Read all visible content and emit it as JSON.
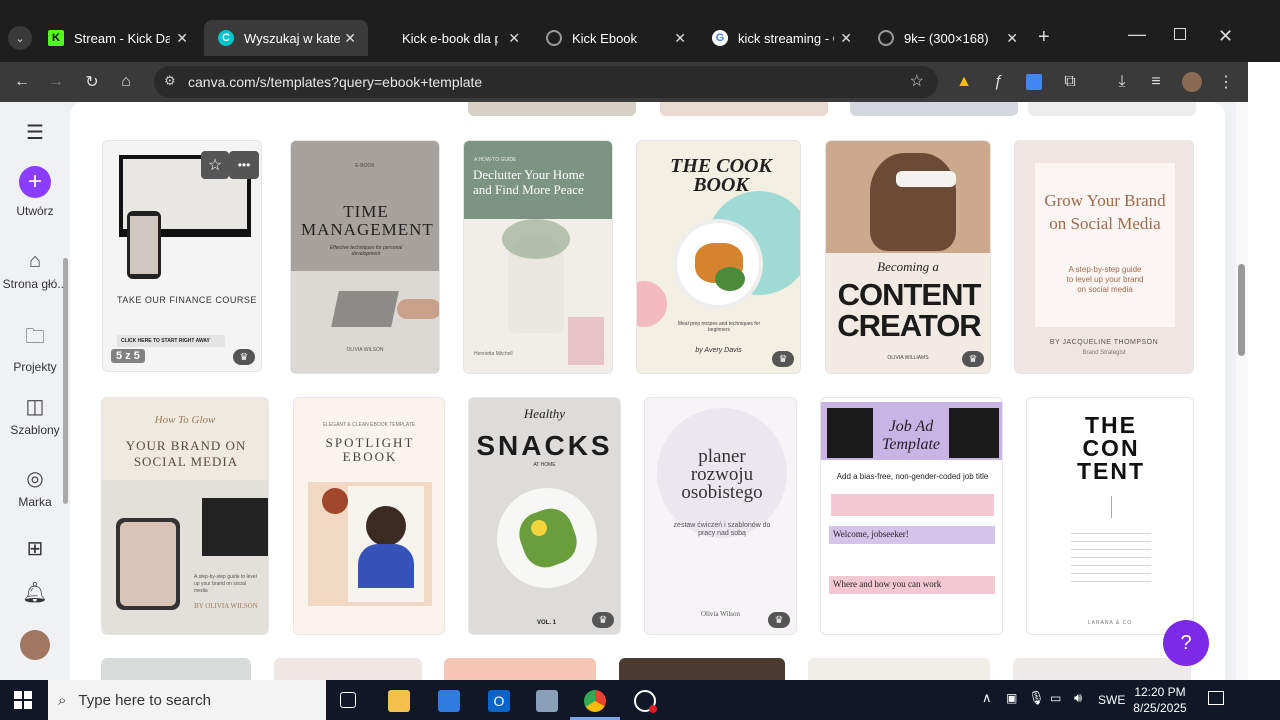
{
  "browser": {
    "tabs": [
      {
        "title": "Stream - Kick Dash",
        "icon": "kick-icon"
      },
      {
        "title": "Wyszukaj w kateg",
        "icon": "canva-icon"
      },
      {
        "title": "Kick e-book dla p",
        "icon": "kick-icon"
      },
      {
        "title": "Kick Ebook",
        "icon": "globe-icon"
      },
      {
        "title": "kick streaming - G",
        "icon": "google-icon"
      },
      {
        "title": "9k= (300×168)",
        "icon": "globe-icon"
      }
    ],
    "url": "canva.com/s/templates?query=ebook+template"
  },
  "sidebar": {
    "create_label": "Utwórz",
    "home_label": "Strona głó...",
    "projects_label": "Projekty",
    "templates_label": "Szablony",
    "brand_label": "Marka"
  },
  "templates": {
    "row1": [
      {
        "title": "TAKE OUR FINANCE COURSE",
        "subtitle": "CLICK HERE TO START RIGHT AWAY",
        "badge": "5 z 5"
      },
      {
        "title": "TIME MANAGEMENT",
        "kicker": "E-BOOK",
        "subtitle": "Effective techniques for personal development",
        "author": "OLIVIA WILSON"
      },
      {
        "title": "Declutter Your Home and Find More Peace",
        "kicker": "A HOW-TO GUIDE",
        "author": "Henrietta Mitchell"
      },
      {
        "title": "THE COOK BOOK",
        "subtitle": "Meal prep recipes and techniques for beginners",
        "author": "by Avery Davis"
      },
      {
        "title": "CONTENT CREATOR",
        "kicker": "Becoming a",
        "author": "OLIVIA WILLIAMS"
      },
      {
        "title": "Grow Your Brand on Social Media",
        "subtitle": "A step-by-step guide to level up your brand on social media",
        "author": "BY JACQUELINE THOMPSON",
        "role": "Brand Strategist"
      }
    ],
    "row2": [
      {
        "title": "YOUR BRAND ON SOCIAL MEDIA",
        "kicker": "How To Glow",
        "subtitle": "A step-by-step guide to level up your brand on social media",
        "author": "BY OLIVIA WILSON"
      },
      {
        "title": "SPOTLIGHT EBOOK",
        "kicker": "ELEGANT & CLEAN EBOOK TEMPLATE"
      },
      {
        "title": "SNACKS",
        "kicker": "Healthy",
        "subtitle": "AT HOME",
        "volume": "VOL. 1"
      },
      {
        "title": "planer rozwoju osobistego",
        "subtitle": "zestaw ćwiczeń i szablonów do pracy nad sobą",
        "author": "Olivia Wilson"
      },
      {
        "title": "Job Ad Template",
        "line1": "Add a bias-free, non-gender-coded job title",
        "line2": "Welcome, jobseeker!",
        "line3": "Where and how you can work"
      },
      {
        "title": "THE CON TENT",
        "author": "LARANA & CO"
      }
    ]
  },
  "taskbar": {
    "search_placeholder": "Type here to search",
    "lang": "SWE",
    "time": "12:20 PM",
    "date": "8/25/2025"
  },
  "help_label": "?"
}
